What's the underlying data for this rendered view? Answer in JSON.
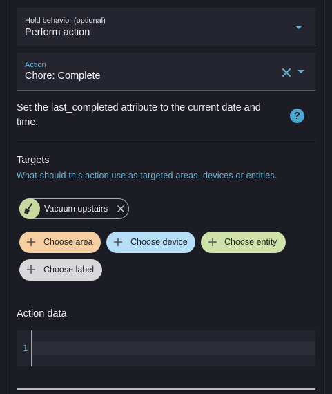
{
  "hold_behavior": {
    "label": "Hold behavior (optional)",
    "value": "Perform action"
  },
  "action": {
    "label": "Action",
    "value": "Chore: Complete"
  },
  "description": "Set the last_completed attribute to the current date and time.",
  "targets": {
    "title": "Targets",
    "subtitle": "What should this action use as targeted areas, devices or entities.",
    "selected": [
      {
        "label": "Vacuum upstairs",
        "icon": "broom-icon"
      }
    ],
    "add_buttons": [
      {
        "label": "Choose area",
        "color": "#f5cfa1"
      },
      {
        "label": "Choose device",
        "color": "#b6def6"
      },
      {
        "label": "Choose entity",
        "color": "#cfe2a9"
      },
      {
        "label": "Choose label",
        "color": "#d8d8da"
      }
    ]
  },
  "action_data": {
    "title": "Action data",
    "line_number": "1"
  },
  "colors": {
    "accent": "#61b4d8",
    "background": "#1c1c24",
    "field": "#25252f"
  }
}
